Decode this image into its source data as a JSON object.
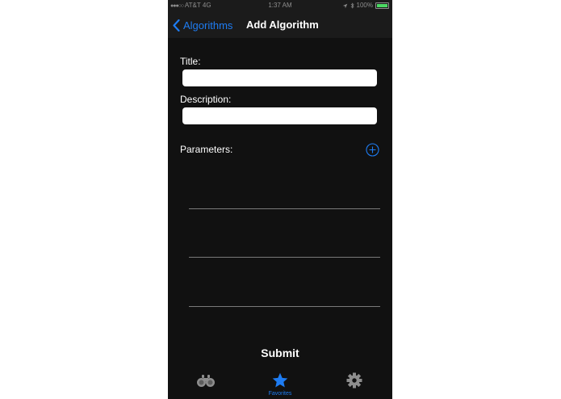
{
  "status_bar": {
    "carrier": "AT&T",
    "network": "4G",
    "time": "1:37 AM",
    "battery": "100%",
    "battery_level": 1.0
  },
  "nav": {
    "back_label": "Algorithms",
    "title": "Add Algorithm"
  },
  "form": {
    "title_label": "Title:",
    "title_value": "",
    "description_label": "Description:",
    "description_value": "",
    "parameters_label": "Parameters:",
    "submit_label": "Submit"
  },
  "tabs": [
    {
      "icon": "binoculars-icon",
      "label": "",
      "active": false
    },
    {
      "icon": "star-icon",
      "label": "Favorites",
      "active": true
    },
    {
      "icon": "gear-icon",
      "label": "",
      "active": false
    }
  ],
  "colors": {
    "accent": "#1e7cf2",
    "background": "#111111",
    "bar": "#1b1b1b",
    "battery": "#4cd964"
  }
}
